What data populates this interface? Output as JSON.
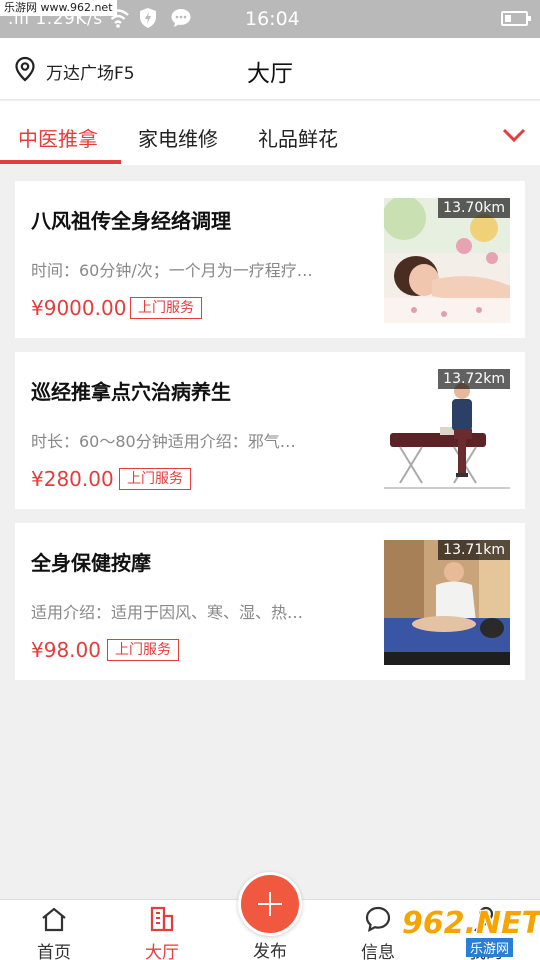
{
  "status_bar": {
    "watermark": "乐游网 www.962.net",
    "speed": ".ıll 1.29K/s",
    "time": "16:04",
    "icons": [
      "wifi-icon",
      "shield-icon",
      "message-icon"
    ]
  },
  "header": {
    "location": "万达广场F5",
    "title": "大厅"
  },
  "tabs": [
    {
      "label": "中医推拿",
      "active": true
    },
    {
      "label": "家电维修",
      "active": false
    },
    {
      "label": "礼品鲜花",
      "active": false
    }
  ],
  "listings": [
    {
      "name": "八风祖传全身经络调理",
      "desc": "时间：60分钟/次；一个月为一疗程疗…",
      "price": "¥9000.00",
      "tag": "上门服务",
      "distance": "13.70km"
    },
    {
      "name": "巡经推拿点穴治病养生",
      "desc": "时长：60～80分钟适用介绍：邪气…",
      "price": "¥280.00",
      "tag": "上门服务",
      "distance": "13.72km"
    },
    {
      "name": "全身保健按摩",
      "desc": "适用介绍：适用于因风、寒、湿、热…",
      "price": "¥98.00",
      "tag": "上门服务",
      "distance": "13.71km"
    }
  ],
  "bottom_nav": [
    {
      "label": "首页",
      "icon": "home-icon",
      "active": false
    },
    {
      "label": "大厅",
      "icon": "hall-icon",
      "active": true
    },
    {
      "label": "发布",
      "icon": "plus-icon",
      "active": false
    },
    {
      "label": "信息",
      "icon": "chat-icon",
      "active": false
    },
    {
      "label": "我的",
      "icon": "user-icon",
      "active": false
    }
  ],
  "watermark_logo": {
    "big": "962.NET",
    "small": "乐游网"
  },
  "colors": {
    "accent": "#e53c3c",
    "publish": "#f0583f",
    "status_bar": "#b9b9b9"
  }
}
